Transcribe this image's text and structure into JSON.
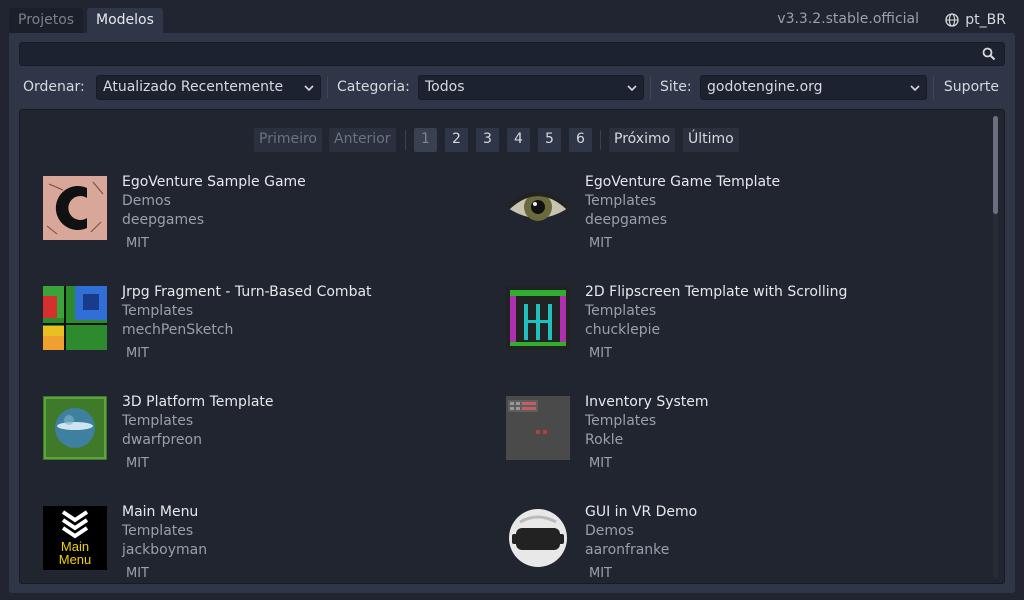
{
  "tabs": [
    {
      "label": "Projetos"
    },
    {
      "label": "Modelos"
    }
  ],
  "version": "v3.3.2.stable.official",
  "language": "pt_BR",
  "search": {
    "value": "",
    "placeholder": ""
  },
  "filters": {
    "sort_label": "Ordenar:",
    "sort_value": "Atualizado Recentemente",
    "category_label": "Categoria:",
    "category_value": "Todos",
    "site_label": "Site:",
    "site_value": "godotengine.org",
    "support_label": "Suporte"
  },
  "pager": {
    "first": "Primeiro",
    "previous": "Anterior",
    "pages": [
      "1",
      "2",
      "3",
      "4",
      "5",
      "6"
    ],
    "current_page": "1",
    "next": "Próximo",
    "last": "Último"
  },
  "assets": [
    {
      "title": "EgoVenture Sample Game",
      "category": "Demos",
      "author": "deepgames",
      "license": "MIT",
      "icon": "egoventure-c-icon"
    },
    {
      "title": "EgoVenture Game Template",
      "category": "Templates",
      "author": "deepgames",
      "license": "MIT",
      "icon": "eye-icon"
    },
    {
      "title": "Jrpg Fragment - Turn-Based Combat",
      "category": "Templates",
      "author": "mechPenSketch",
      "license": "MIT",
      "icon": "puzzle-icon"
    },
    {
      "title": "2D Flipscreen Template with Scrolling",
      "category": "Templates",
      "author": "chucklepie",
      "license": "MIT",
      "icon": "retro-level-icon"
    },
    {
      "title": "3D Platform Template",
      "category": "Templates",
      "author": "dwarfpreon",
      "license": "MIT",
      "icon": "globe-platform-icon"
    },
    {
      "title": "Inventory System",
      "category": "Templates",
      "author": "Rokle",
      "license": "MIT",
      "icon": "inventory-grid-icon"
    },
    {
      "title": "Main Menu",
      "category": "Templates",
      "author": "jackboyman",
      "license": "MIT",
      "icon": "main-menu-icon",
      "icon_text_1": "Main",
      "icon_text_2": "Menu"
    },
    {
      "title": "GUI in VR Demo",
      "category": "Demos",
      "author": "aaronfranke",
      "license": "MIT",
      "icon": "vr-headset-icon"
    }
  ],
  "colors": {
    "background": "#202531",
    "panel": "#2f3647",
    "list_bg": "#20252f",
    "text": "#d6d9de",
    "muted": "#9aa0ab"
  }
}
